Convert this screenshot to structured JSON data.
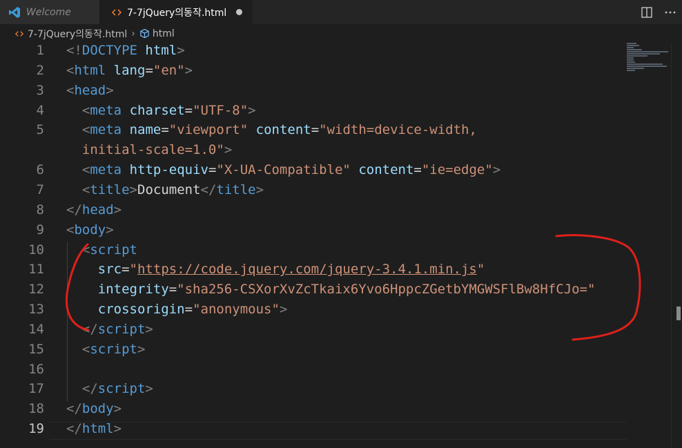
{
  "tabs": [
    {
      "label": "Welcome"
    },
    {
      "label": "7-7jQuery의동작.html"
    }
  ],
  "breadcrumb": {
    "file": "7-7jQuery의동작.html",
    "element": "html"
  },
  "editor": {
    "current_line": "19",
    "lines": [
      {
        "number": "1",
        "segments": [
          [
            "punct",
            "<!"
          ],
          [
            "tag",
            "DOCTYPE"
          ],
          [
            "plain",
            " "
          ],
          [
            "attr",
            "html"
          ],
          [
            "punct",
            ">"
          ]
        ]
      },
      {
        "number": "2",
        "segments": [
          [
            "punct",
            "<"
          ],
          [
            "tag",
            "html"
          ],
          [
            "plain",
            " "
          ],
          [
            "attr",
            "lang"
          ],
          [
            "plain",
            "="
          ],
          [
            "str",
            "\"en\""
          ],
          [
            "punct",
            ">"
          ]
        ]
      },
      {
        "number": "3",
        "segments": [
          [
            "punct",
            "<"
          ],
          [
            "tag",
            "head"
          ],
          [
            "punct",
            ">"
          ]
        ]
      },
      {
        "number": "4",
        "segments": [
          [
            "plain",
            "  "
          ],
          [
            "punct",
            "<"
          ],
          [
            "tag",
            "meta"
          ],
          [
            "plain",
            " "
          ],
          [
            "attr",
            "charset"
          ],
          [
            "plain",
            "="
          ],
          [
            "str",
            "\"UTF-8\""
          ],
          [
            "punct",
            ">"
          ]
        ]
      },
      {
        "number": "5",
        "segments": [
          [
            "plain",
            "  "
          ],
          [
            "punct",
            "<"
          ],
          [
            "tag",
            "meta"
          ],
          [
            "plain",
            " "
          ],
          [
            "attr",
            "name"
          ],
          [
            "plain",
            "="
          ],
          [
            "str",
            "\"viewport\""
          ],
          [
            "plain",
            " "
          ],
          [
            "attr",
            "content"
          ],
          [
            "plain",
            "="
          ],
          [
            "str",
            "\"width=device-width,"
          ]
        ]
      },
      {
        "number": "",
        "segments": [
          [
            "str",
            "  initial-scale=1.0\""
          ],
          [
            "punct",
            ">"
          ]
        ]
      },
      {
        "number": "6",
        "segments": [
          [
            "plain",
            "  "
          ],
          [
            "punct",
            "<"
          ],
          [
            "tag",
            "meta"
          ],
          [
            "plain",
            " "
          ],
          [
            "attr",
            "http-equiv"
          ],
          [
            "plain",
            "="
          ],
          [
            "str",
            "\"X-UA-Compatible\""
          ],
          [
            "plain",
            " "
          ],
          [
            "attr",
            "content"
          ],
          [
            "plain",
            "="
          ],
          [
            "str",
            "\"ie=edge\""
          ],
          [
            "punct",
            ">"
          ]
        ]
      },
      {
        "number": "7",
        "segments": [
          [
            "plain",
            "  "
          ],
          [
            "punct",
            "<"
          ],
          [
            "tag",
            "title"
          ],
          [
            "punct",
            ">"
          ],
          [
            "plain",
            "Document"
          ],
          [
            "punct",
            "</"
          ],
          [
            "tag",
            "title"
          ],
          [
            "punct",
            ">"
          ]
        ]
      },
      {
        "number": "8",
        "segments": [
          [
            "punct",
            "</"
          ],
          [
            "tag",
            "head"
          ],
          [
            "punct",
            ">"
          ]
        ]
      },
      {
        "number": "9",
        "segments": [
          [
            "punct",
            "<"
          ],
          [
            "tag",
            "body"
          ],
          [
            "punct",
            ">"
          ]
        ]
      },
      {
        "number": "10",
        "segments": [
          [
            "plain",
            "  "
          ],
          [
            "punct",
            "<"
          ],
          [
            "tag",
            "script"
          ]
        ]
      },
      {
        "number": "11",
        "segments": [
          [
            "plain",
            "    "
          ],
          [
            "attr",
            "src"
          ],
          [
            "plain",
            "="
          ],
          [
            "str",
            "\""
          ],
          [
            "str_u",
            "https://code.jquery.com/jquery-3.4.1.min.js"
          ],
          [
            "str",
            "\""
          ]
        ]
      },
      {
        "number": "12",
        "segments": [
          [
            "plain",
            "    "
          ],
          [
            "attr",
            "integrity"
          ],
          [
            "plain",
            "="
          ],
          [
            "str",
            "\"sha256-CSXorXvZcTkaix6Yvo6HppcZGetbYMGWSFlBw8HfCJo=\""
          ]
        ]
      },
      {
        "number": "13",
        "segments": [
          [
            "plain",
            "    "
          ],
          [
            "attr",
            "crossorigin"
          ],
          [
            "plain",
            "="
          ],
          [
            "str",
            "\"anonymous\""
          ],
          [
            "punct",
            ">"
          ]
        ]
      },
      {
        "number": "14",
        "segments": [
          [
            "plain",
            "  "
          ],
          [
            "punct",
            "</"
          ],
          [
            "tag",
            "script"
          ],
          [
            "punct",
            ">"
          ]
        ]
      },
      {
        "number": "15",
        "segments": [
          [
            "plain",
            "  "
          ],
          [
            "punct",
            "<"
          ],
          [
            "tag",
            "script"
          ],
          [
            "punct",
            ">"
          ]
        ]
      },
      {
        "number": "16",
        "segments": []
      },
      {
        "number": "17",
        "segments": [
          [
            "plain",
            "  "
          ],
          [
            "punct",
            "</"
          ],
          [
            "tag",
            "script"
          ],
          [
            "punct",
            ">"
          ]
        ]
      },
      {
        "number": "18",
        "segments": [
          [
            "punct",
            "</"
          ],
          [
            "tag",
            "body"
          ],
          [
            "punct",
            ">"
          ]
        ]
      },
      {
        "number": "19",
        "segments": [
          [
            "punct",
            "</"
          ],
          [
            "tag",
            "html"
          ],
          [
            "punct",
            ">"
          ]
        ]
      }
    ]
  },
  "colors": {
    "background": "#1e1e1e",
    "tabbar": "#252526",
    "tag": "#569cd6",
    "attribute": "#9cdcfe",
    "string": "#ce9178",
    "punctuation": "#808080",
    "annotation": "#e0201a"
  },
  "icons": [
    "vscode-logo-icon",
    "html-file-icon",
    "split-editor-icon",
    "more-actions-icon",
    "breadcrumb-element-icon"
  ]
}
